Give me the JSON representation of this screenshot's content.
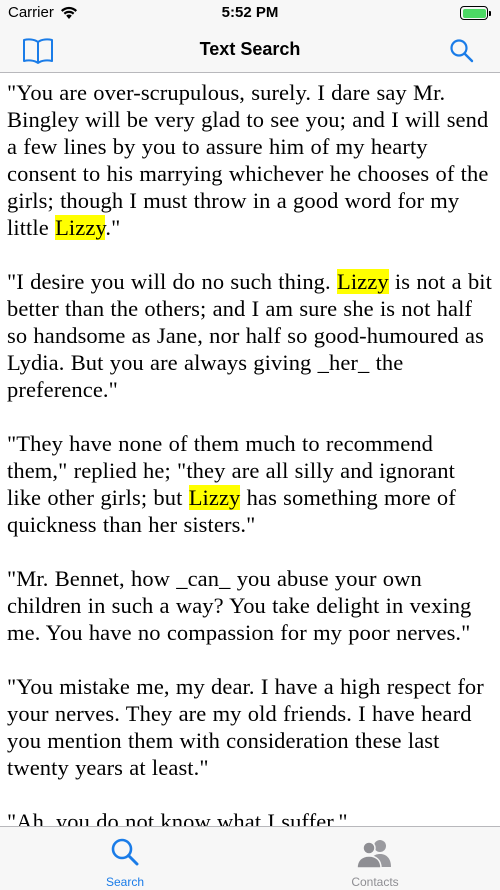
{
  "status_bar": {
    "carrier": "Carrier",
    "time": "5:52 PM"
  },
  "nav": {
    "title": "Text Search",
    "left_icon": "book-icon",
    "right_icon": "search-icon"
  },
  "content": {
    "highlight_term": "Lizzy",
    "paragraphs": [
      {
        "before": "\"You are over-scrupulous, surely. I dare say Mr. Bingley will be very glad to see you; and I will send a few lines by you to assure him of my hearty consent to his marrying whichever he chooses of the girls; though I must throw in a good word for my little ",
        "highlight": "Lizzy",
        "after": ".\""
      },
      {
        "before": "\"I desire you will do no such thing. ",
        "highlight": "Lizzy",
        "after": " is not a bit better than the others; and I am sure she is not half so handsome as Jane, nor half so good-humoured as Lydia. But you are always giving _her_ the preference.\""
      },
      {
        "before": "\"They have none of them much to recommend them,\" replied he; \"they are all silly and ignorant like other girls; but ",
        "highlight": "Lizzy",
        "after": " has something more of quickness than her sisters.\""
      },
      {
        "text": "\"Mr. Bennet, how _can_ you abuse your own children in such a way? You take delight in vexing me. You have no compassion for my poor nerves.\""
      },
      {
        "text": "\"You mistake me, my dear. I have a high respect for your nerves. They are my old friends. I have heard you mention them with consideration these last twenty years at least.\""
      },
      {
        "text": "\"Ah, you do not know what I suffer.\""
      }
    ]
  },
  "tab_bar": {
    "tabs": [
      {
        "label": "Search",
        "icon": "search-icon",
        "active": true
      },
      {
        "label": "Contacts",
        "icon": "contacts-icon",
        "active": false
      }
    ]
  },
  "colors": {
    "accent": "#1a7ce8",
    "highlight": "#ffff00",
    "inactive": "#8e8e93",
    "battery": "#4cd964"
  }
}
